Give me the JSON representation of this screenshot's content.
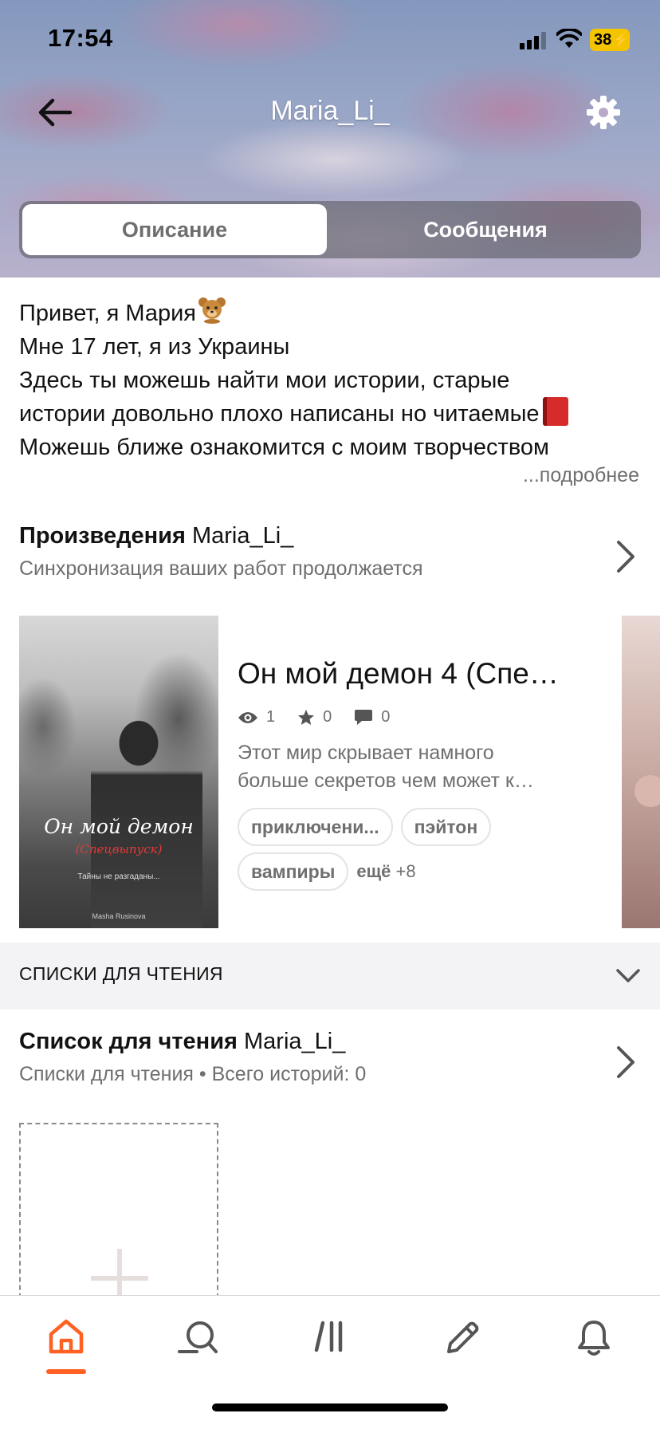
{
  "status_bar": {
    "time": "17:54",
    "battery": "38"
  },
  "header": {
    "profile_name": "Maria_Li_",
    "tabs": [
      {
        "label": "Описание",
        "active": true
      },
      {
        "label": "Сообщения",
        "active": false
      }
    ]
  },
  "bio": {
    "lines": [
      "Привет, я Мария",
      "Мне 17 лет, я из Украины",
      "Здесь ты можешь найти мои истории, старые",
      "истории довольно плохо написаны но читаемые",
      "Можешь ближе ознакомится с моим творчеством"
    ],
    "more_label": "...подробнее"
  },
  "works": {
    "title_bold": "Произведения",
    "title_name": "Maria_Li_",
    "subtitle": "Синхронизация ваших работ продолжается",
    "story": {
      "title": "Он мой демон 4 (Спе…",
      "views": "1",
      "votes": "0",
      "comments": "0",
      "description": [
        "Этот мир скрывает намного",
        "больше секретов чем может к…"
      ],
      "tags": [
        "приключени...",
        "пэйтон",
        "вампиры"
      ],
      "more_tags_label": "ещё",
      "more_tags_count": "+8",
      "cover": {
        "title": "Он мой демон",
        "subtitle": "(Спецвыпуск)",
        "tagline": "Тайны не разгаданы...",
        "author": "Masha Rusinova"
      }
    }
  },
  "reading_lists": {
    "bar_label": "СПИСКИ ДЛЯ ЧТЕНИЯ",
    "title_bold": "Список для чтения",
    "title_name": "Maria_Li_",
    "subtitle": "Списки для чтения • Всего историй: 0"
  },
  "tabbar": {
    "items": [
      "home-icon",
      "search-icon",
      "library-icon",
      "write-icon",
      "notifications-icon"
    ],
    "active_index": 0
  },
  "colors": {
    "accent": "#ff6122",
    "text_primary": "#121212",
    "text_secondary": "#6f6f6f",
    "battery": "#f5c400"
  }
}
